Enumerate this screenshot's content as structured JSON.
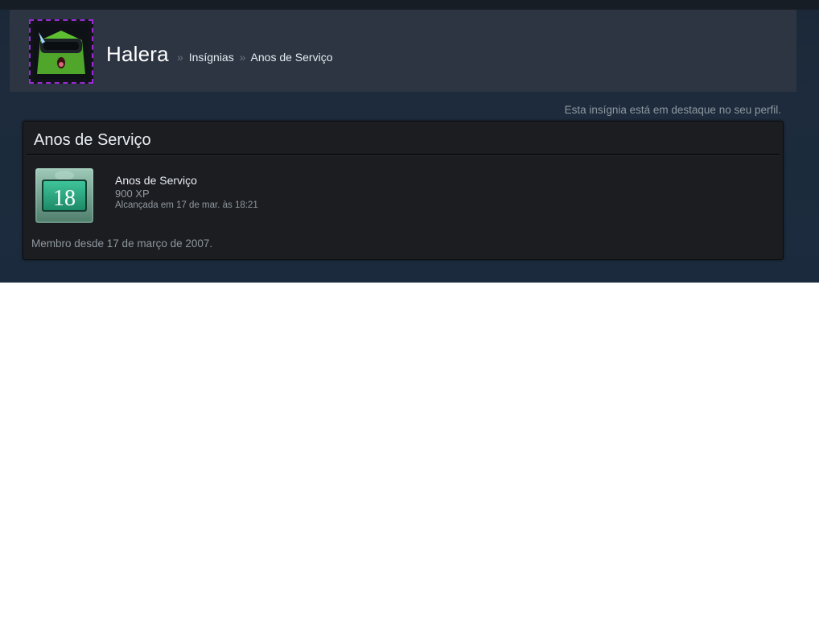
{
  "header": {
    "persona_name": "Halera",
    "breadcrumb": {
      "separator": "»",
      "items": [
        "Insígnias",
        "Anos de Serviço"
      ]
    },
    "avatar_icon": "green-cube-vr-headset-avatar"
  },
  "featured_notice": "Esta insígnia está em destaque no seu perfil.",
  "badge_panel": {
    "title": "Anos de Serviço",
    "badge": {
      "icon": "years-of-service-badge-icon",
      "icon_number": "18",
      "name": "Anos de Serviço",
      "xp": "900 XP",
      "unlocked": "Alcançada em 17 de mar. às 18:21"
    },
    "member_since": "Membro desde 17 de março de 2007."
  },
  "colors": {
    "page_bg": "#1b2838",
    "header_bg": "#2c3541",
    "panel_bg": "#1c1d20",
    "avatar_frame": "#9b2ad6",
    "badge_green": "#2fa27e",
    "muted_text": "#8f98a0"
  }
}
